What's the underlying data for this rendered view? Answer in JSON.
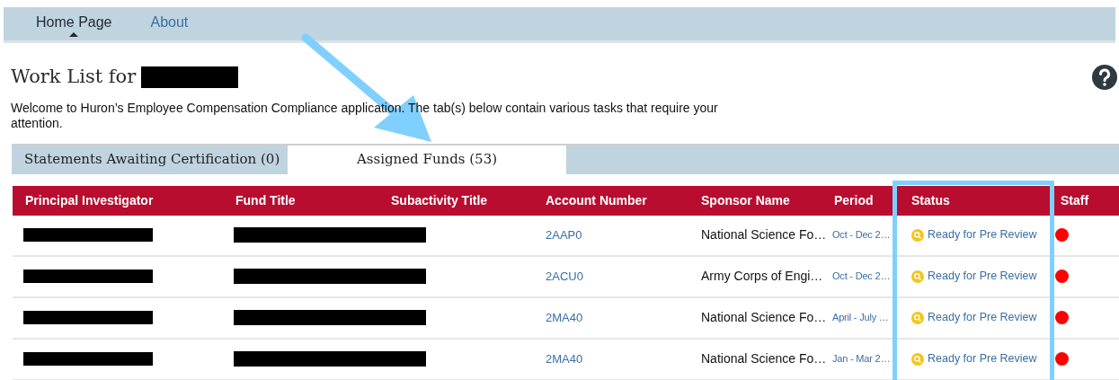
{
  "nav": [
    {
      "label": "Home Page",
      "selected": true
    },
    {
      "label": "About",
      "selected": false
    }
  ],
  "title": "Work List for",
  "welcome": "Welcome to Huron’s Employee Compensation Compliance application. The tab(s) below contain various tasks that require your attention.",
  "tabs": [
    {
      "label": "Statements Awaiting Certification (0)",
      "selected": false
    },
    {
      "label": "Assigned Funds (53)",
      "selected": true
    }
  ],
  "table": {
    "columns": [
      "Principal Investigator",
      "Fund Title",
      "Subactivity Title",
      "Account Number",
      "Sponsor Name",
      "Period",
      "Status",
      "Staff"
    ],
    "rows": [
      {
        "account": "2AAP0",
        "sponsor": "National Science Fo…",
        "period": "Oct - Dec 2…",
        "status": "Ready for Pre Review",
        "color": "#ff0000"
      },
      {
        "account": "2ACU0",
        "sponsor": "Army Corps of Engi…",
        "period": "Oct - Dec 2…",
        "status": "Ready for Pre Review",
        "color": "#ff0000"
      },
      {
        "account": "2MA40",
        "sponsor": "National Science Fo…",
        "period": "April - July …",
        "status": "Ready for Pre Review",
        "color": "#ff0000"
      },
      {
        "account": "2MA40",
        "sponsor": "National Science Fo…",
        "period": "Jan - Mar 2…",
        "status": "Ready for Pre Review",
        "color": "#ff0000"
      }
    ]
  }
}
